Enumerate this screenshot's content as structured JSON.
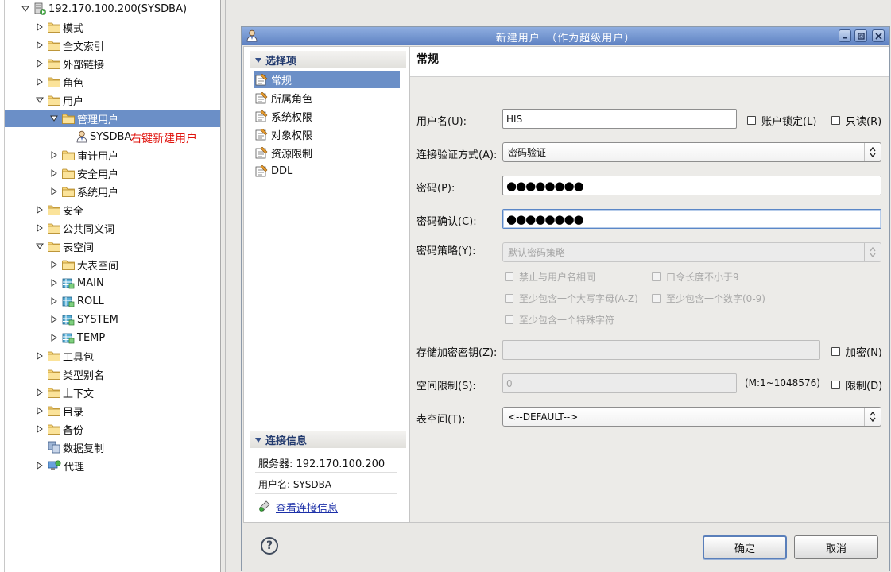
{
  "tree": {
    "items": [
      {
        "label": "192.170.100.200(SYSDBA)",
        "icon": "database-server-icon",
        "expander": "open",
        "selected": false
      },
      {
        "label": "模式",
        "icon": "folder-icon",
        "expander": "closed",
        "selected": false
      },
      {
        "label": "全文索引",
        "icon": "folder-icon",
        "expander": "closed",
        "selected": false
      },
      {
        "label": "外部链接",
        "icon": "folder-icon",
        "expander": "closed",
        "selected": false
      },
      {
        "label": "角色",
        "icon": "folder-icon",
        "expander": "closed",
        "selected": false
      },
      {
        "label": "用户",
        "icon": "folder-icon",
        "expander": "open",
        "selected": false
      },
      {
        "label": "管理用户",
        "icon": "folder-icon",
        "expander": "open",
        "selected": true
      },
      {
        "label": "SYSDBA",
        "icon": "user-icon",
        "expander": "none",
        "selected": false
      },
      {
        "label": "审计用户",
        "icon": "folder-icon",
        "expander": "closed",
        "selected": false
      },
      {
        "label": "安全用户",
        "icon": "folder-icon",
        "expander": "closed",
        "selected": false
      },
      {
        "label": "系统用户",
        "icon": "folder-icon",
        "expander": "closed",
        "selected": false
      },
      {
        "label": "安全",
        "icon": "folder-icon",
        "expander": "closed",
        "selected": false
      },
      {
        "label": "公共同义词",
        "icon": "folder-icon",
        "expander": "closed",
        "selected": false
      },
      {
        "label": "表空间",
        "icon": "folder-icon",
        "expander": "open",
        "selected": false
      },
      {
        "label": "大表空间",
        "icon": "folder-icon",
        "expander": "closed",
        "selected": false
      },
      {
        "label": "MAIN",
        "icon": "tablespace-icon",
        "expander": "closed",
        "selected": false
      },
      {
        "label": "ROLL",
        "icon": "tablespace-icon",
        "expander": "closed",
        "selected": false
      },
      {
        "label": "SYSTEM",
        "icon": "tablespace-icon",
        "expander": "closed",
        "selected": false
      },
      {
        "label": "TEMP",
        "icon": "tablespace-icon",
        "expander": "closed",
        "selected": false
      },
      {
        "label": "工具包",
        "icon": "folder-icon",
        "expander": "closed",
        "selected": false
      },
      {
        "label": "类型别名",
        "icon": "folder-icon",
        "expander": "none",
        "selected": false
      },
      {
        "label": "上下文",
        "icon": "folder-icon",
        "expander": "closed",
        "selected": false
      },
      {
        "label": "目录",
        "icon": "folder-icon",
        "expander": "closed",
        "selected": false
      },
      {
        "label": "备份",
        "icon": "folder-icon",
        "expander": "closed",
        "selected": false
      },
      {
        "label": "数据复制",
        "icon": "replication-icon",
        "expander": "none",
        "selected": false
      },
      {
        "label": "代理",
        "icon": "agent-icon",
        "expander": "closed",
        "selected": false
      }
    ],
    "annotation": "右键新建用户"
  },
  "dialog": {
    "title": "新建用户　（作为超级用户）",
    "nav_header": "选择项",
    "nav_items": [
      {
        "label": "常规",
        "selected": true
      },
      {
        "label": "所属角色",
        "selected": false
      },
      {
        "label": "系统权限",
        "selected": false
      },
      {
        "label": "对象权限",
        "selected": false
      },
      {
        "label": "资源限制",
        "selected": false
      },
      {
        "label": "DDL",
        "selected": false
      }
    ],
    "conn_header": "连接信息",
    "server_text": "服务器: 192.170.100.200",
    "user_text": "用户名: SYSDBA",
    "conn_link": "查看连接信息",
    "section_title": "常规",
    "form": {
      "username_label": "用户名(U):",
      "username_value": "HIS",
      "lock_label": "账户锁定(L)",
      "readonly_label": "只读(R)",
      "auth_label": "连接验证方式(A):",
      "auth_value": "密码验证",
      "password_label": "密码(P):",
      "password_value": "●●●●●●●●",
      "confirm_label": "密码确认(C):",
      "confirm_value": "●●●●●●●●",
      "policy_label": "密码策略(Y):",
      "policy_value": "默认密码策略",
      "policy_options": [
        "禁止与用户名相同",
        "口令长度不小于9",
        "至少包含一个大写字母(A-Z)",
        "至少包含一个数字(0-9)",
        "至少包含一个特殊字符"
      ],
      "encrypt_key_label": "存储加密密钥(Z):",
      "encrypt_key_value": "",
      "encrypt_label": "加密(N)",
      "space_label": "空间限制(S):",
      "space_value": "0",
      "space_range": "(M:1~1048576)",
      "limit_label": "限制(D)",
      "tablespace_label": "表空间(T):",
      "tablespace_value": "<--DEFAULT-->"
    },
    "ok_label": "确定",
    "cancel_label": "取消",
    "help_glyph": "?"
  }
}
